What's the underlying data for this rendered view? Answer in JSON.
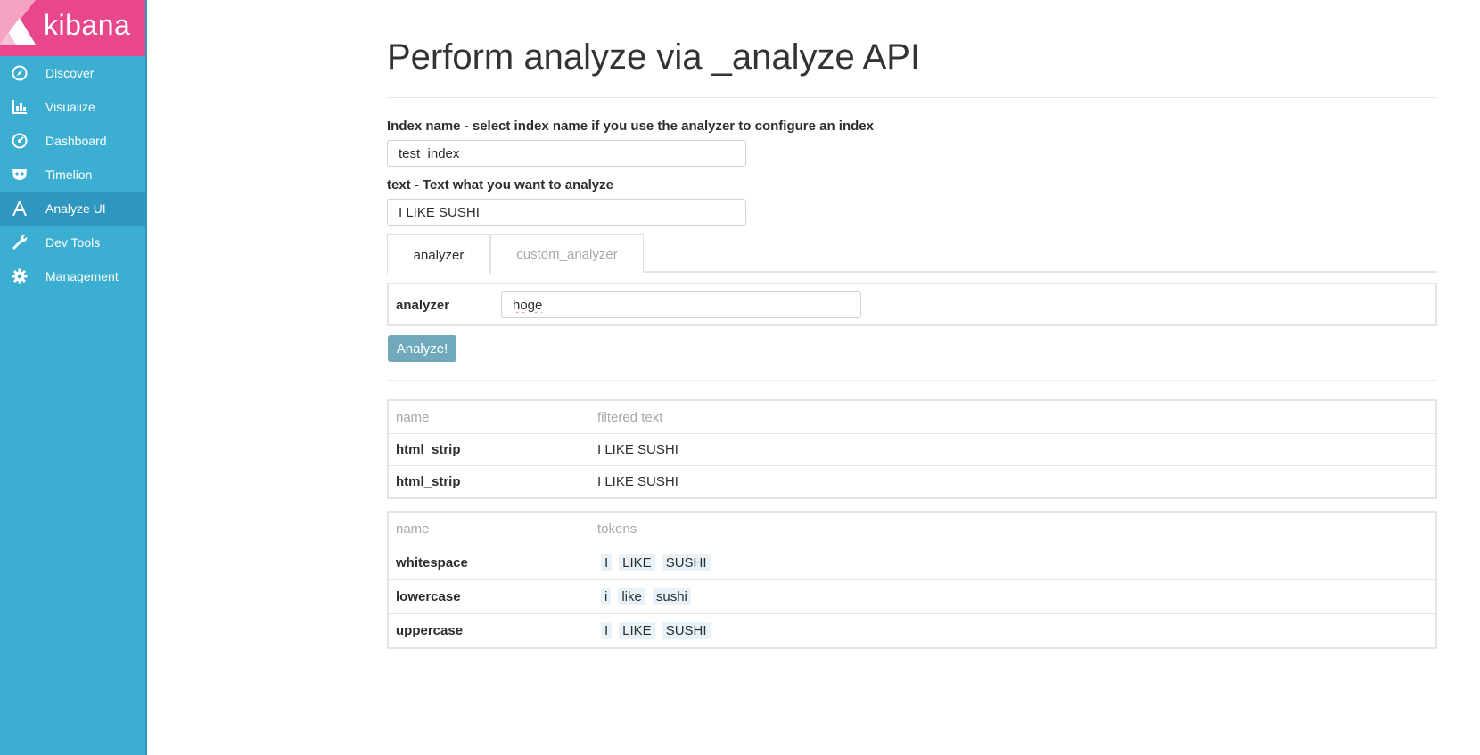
{
  "app": {
    "logo_text": "kibana"
  },
  "sidebar": {
    "items": [
      {
        "label": "Discover",
        "icon": "compass-icon"
      },
      {
        "label": "Visualize",
        "icon": "bar-chart-icon"
      },
      {
        "label": "Dashboard",
        "icon": "dashboard-gauge-icon"
      },
      {
        "label": "Timelion",
        "icon": "timelion-mask-icon"
      },
      {
        "label": "Analyze UI",
        "icon": "letter-a-icon",
        "active": true
      },
      {
        "label": "Dev Tools",
        "icon": "wrench-icon"
      },
      {
        "label": "Management",
        "icon": "gear-icon"
      }
    ]
  },
  "page": {
    "title": "Perform analyze via _analyze API"
  },
  "form": {
    "index_label": "Index name - select index name if you use the analyzer to configure an index",
    "index_value": "test_index",
    "text_label": "text - Text what you want to analyze",
    "text_value": "I LIKE SUSHI"
  },
  "tabs": [
    {
      "label": "analyzer",
      "active": true
    },
    {
      "label": "custom_analyzer",
      "active": false
    }
  ],
  "analyzer_panel": {
    "label": "analyzer",
    "value": "hoge"
  },
  "analyze_button": "Analyze!",
  "char_filter_table": {
    "headers": [
      "name",
      "filtered text"
    ],
    "rows": [
      {
        "name": "html_strip",
        "text": "I LIKE SUSHI"
      },
      {
        "name": "html_strip",
        "text": "I LIKE SUSHI"
      }
    ]
  },
  "token_table": {
    "headers": [
      "name",
      "tokens"
    ],
    "rows": [
      {
        "name": "whitespace",
        "tokens": [
          "I",
          "LIKE",
          "SUSHI"
        ]
      },
      {
        "name": "lowercase",
        "tokens": [
          "i",
          "like",
          "sushi"
        ]
      },
      {
        "name": "uppercase",
        "tokens": [
          "I",
          "LIKE",
          "SUSHI"
        ]
      }
    ]
  },
  "colors": {
    "sidebar": "#3caed2",
    "sidebar_active": "#2f96c0",
    "logo_bg": "#e8478b",
    "button": "#6fa9bb",
    "token_bg": "#e8f2f8"
  }
}
